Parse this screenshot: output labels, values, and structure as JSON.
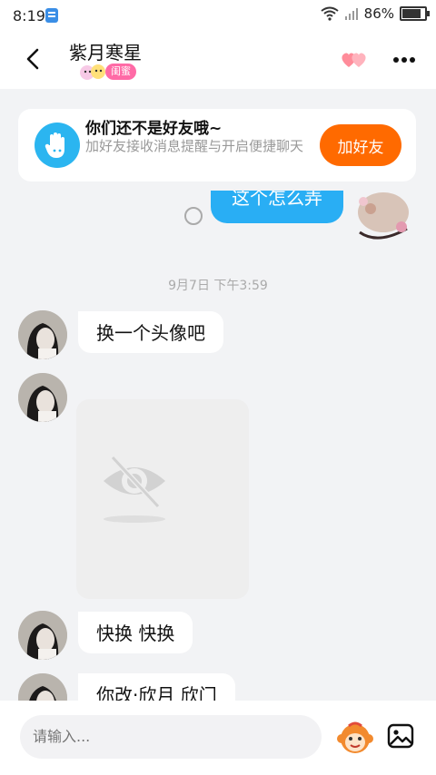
{
  "status": {
    "time": "8:19",
    "battery": "86%"
  },
  "header": {
    "title": "紫月寒星",
    "badge": "闺蜜"
  },
  "banner": {
    "title": "你们还不是好友哦~",
    "subtitle": "加好友接收消息提醒与开启便捷聊天",
    "button": "加好友"
  },
  "messages": {
    "outgoing_partial": "这个怎么弄",
    "timestamp": "9月7日 下午3:59",
    "m1": "换一个头像吧",
    "m2": "快换 快换",
    "m3": "你改·欣月 欣门"
  },
  "input": {
    "placeholder": "请输入..."
  },
  "colors": {
    "accent_blue": "#29aef4",
    "add_orange": "#ff6a00",
    "badge_pink": "#ff6aa6"
  }
}
